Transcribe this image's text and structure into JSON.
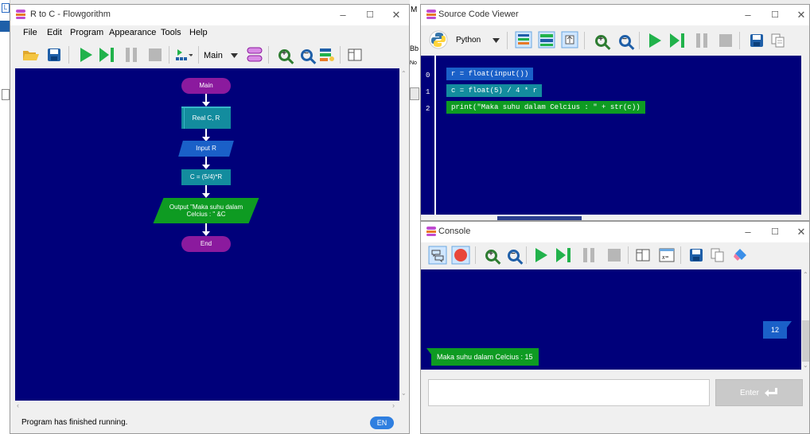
{
  "flowgorithm": {
    "title": "R to C - Flowgorithm",
    "menu": [
      "File",
      "Edit",
      "Program",
      "Appearance",
      "Tools",
      "Help"
    ],
    "function_select": "Main",
    "shapes": {
      "start": "Main",
      "declare": "Real C, R",
      "input": "Input R",
      "assign": "C = (5/4)*R",
      "output_line1": "Output \"Maka suhu dalam",
      "output_line2": "Celcius : \" &C",
      "end": "End"
    },
    "status": "Program has finished running.",
    "language_badge": "EN",
    "colors": {
      "canvas": "#00007a",
      "terminal": "#8b1a9e",
      "declare": "#138c9e",
      "io": "#1a60c8",
      "assign": "#138c9e",
      "output": "#0e9b22"
    }
  },
  "background_partial": {
    "left_letter": "L",
    "m_letter": "M",
    "bb": "Bb",
    "no": "No"
  },
  "source_viewer": {
    "title": "Source Code Viewer",
    "language": "Python",
    "lines": [
      {
        "num": "0",
        "code": "r = float(input())"
      },
      {
        "num": "1",
        "code": "c = float(5) / 4 * r"
      },
      {
        "num": "2",
        "code": "print(\"Maka suhu dalam Celcius : \" + str(c))"
      }
    ]
  },
  "console": {
    "title": "Console",
    "user_input": "12",
    "output_text": "Maka suhu dalam Celcius : 15",
    "input_placeholder": "",
    "enter_label": "Enter"
  },
  "window_controls": {
    "minimize": "–",
    "maximize": "☐",
    "close": "✕"
  }
}
